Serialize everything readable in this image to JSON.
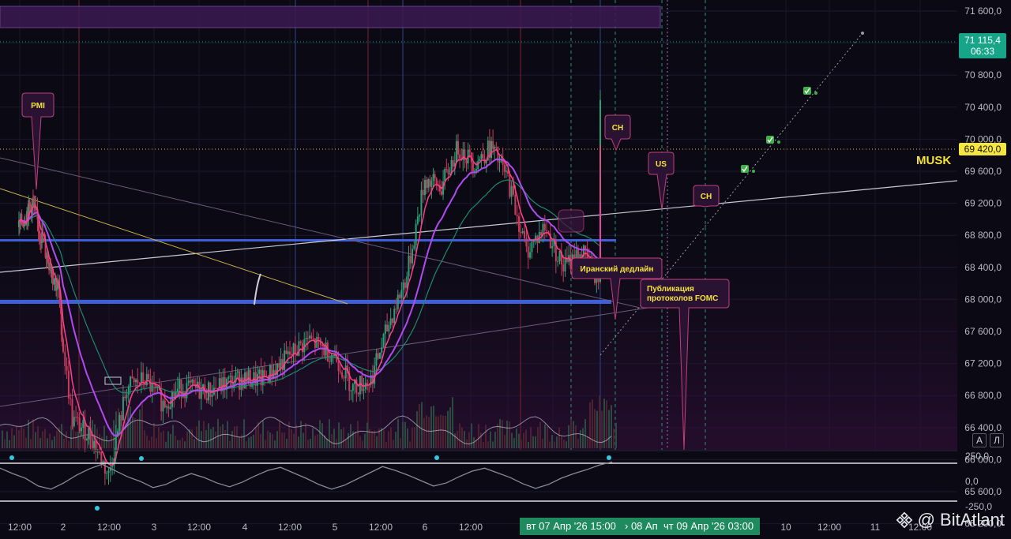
{
  "chart_data": [
    {
      "type": "candlestick",
      "title": "",
      "xlabel": "",
      "ylabel": "",
      "ylim": [
        65200,
        71600
      ],
      "y_ticks": [
        "71 600,0",
        "71 200,0",
        "70 800,0",
        "70 400,0",
        "70 000,0",
        "69 600,0",
        "69 200,0",
        "68 800,0",
        "68 400,0",
        "68 000,0",
        "67 600,0",
        "67 200,0",
        "66 800,0",
        "66 400,0",
        "66 000,0",
        "65 600,0",
        "65 200,0"
      ],
      "y_tick_values": [
        71600,
        71200,
        70800,
        70400,
        70000,
        69600,
        69200,
        68800,
        68400,
        68000,
        67600,
        67200,
        66800,
        66400,
        66000,
        65600,
        65200
      ],
      "x_ticks": [
        "12:00",
        "2",
        "12:00",
        "3",
        "12:00",
        "4",
        "12:00",
        "5",
        "12:00",
        "6",
        "12:00",
        "7",
        "12:00",
        "10",
        "12:00",
        "11",
        "12:00"
      ],
      "price_path": [
        [
          0.0,
          68900
        ],
        [
          0.3,
          69200
        ],
        [
          0.6,
          68600
        ],
        [
          0.9,
          68100
        ],
        [
          1.0,
          67400
        ],
        [
          1.1,
          66500
        ],
        [
          1.3,
          66300
        ],
        [
          1.5,
          65800
        ],
        [
          1.7,
          66900
        ],
        [
          1.9,
          67000
        ],
        [
          2.1,
          66700
        ],
        [
          2.3,
          66900
        ],
        [
          2.6,
          66850
        ],
        [
          2.9,
          67000
        ],
        [
          3.2,
          67000
        ],
        [
          3.5,
          67300
        ],
        [
          3.7,
          67500
        ],
        [
          4.0,
          67300
        ],
        [
          4.2,
          66900
        ],
        [
          4.4,
          67000
        ],
        [
          4.6,
          67700
        ],
        [
          4.8,
          68300
        ],
        [
          5.0,
          69500
        ],
        [
          5.2,
          69400
        ],
        [
          5.4,
          69900
        ],
        [
          5.6,
          69700
        ],
        [
          5.8,
          69900
        ],
        [
          6.0,
          69500
        ],
        [
          6.2,
          68600
        ],
        [
          6.4,
          68900
        ],
        [
          6.6,
          68400
        ],
        [
          6.8,
          68600
        ],
        [
          7.0,
          68200
        ],
        [
          7.1,
          68700
        ],
        [
          7.25,
          69400
        ],
        [
          7.35,
          70700
        ]
      ],
      "current_price": "71 115,4",
      "countdown": "06:33",
      "level_price": "69 420,0",
      "annotations": [
        "PMI",
        "CH",
        "US",
        "CH",
        "Иранский дедлайн",
        "Публикация протоколов FOMC",
        "MUSK"
      ],
      "grid": true,
      "legend": "none"
    },
    {
      "type": "line",
      "title": "",
      "ylim": [
        -250,
        250
      ],
      "y_ticks": [
        "250,0",
        "0,0",
        "-250,0"
      ],
      "y_tick_values": [
        250,
        0,
        -250
      ],
      "series": [
        {
          "values": [
            150,
            80,
            20,
            -80,
            -120,
            -40,
            60,
            140,
            200,
            120,
            40,
            -20,
            -100,
            -60,
            20,
            80,
            30,
            -40,
            -90,
            -30,
            50,
            120,
            160,
            90,
            20,
            -60,
            -120,
            -70,
            10,
            90,
            170,
            120,
            60,
            -10,
            -80,
            -40,
            40,
            110,
            150,
            90,
            30,
            -50,
            -110,
            -60,
            20,
            80,
            130,
            190,
            230
          ]
        }
      ]
    }
  ],
  "time_labels": {
    "start": "вт 07 Апр '26   15:00",
    "range": "› 08 Ап",
    "end": "чт 09 Апр '26   03:00"
  },
  "scale_buttons": {
    "auto": "A",
    "log": "Л"
  },
  "watermark": {
    "text": "@ BitAtlant"
  },
  "colors": {
    "background": "#0b0a14",
    "up": "#2e9e74",
    "down": "#c83c5c",
    "ema_fast": "#ff3f8a",
    "ema_slow": "#b04bf0",
    "current_price_box": "#17a589",
    "level_price_box": "#f5e642",
    "annotation_fill": "#2a1233",
    "annotation_text": "#f5e33a",
    "blue_level": "#3f5fd6"
  }
}
